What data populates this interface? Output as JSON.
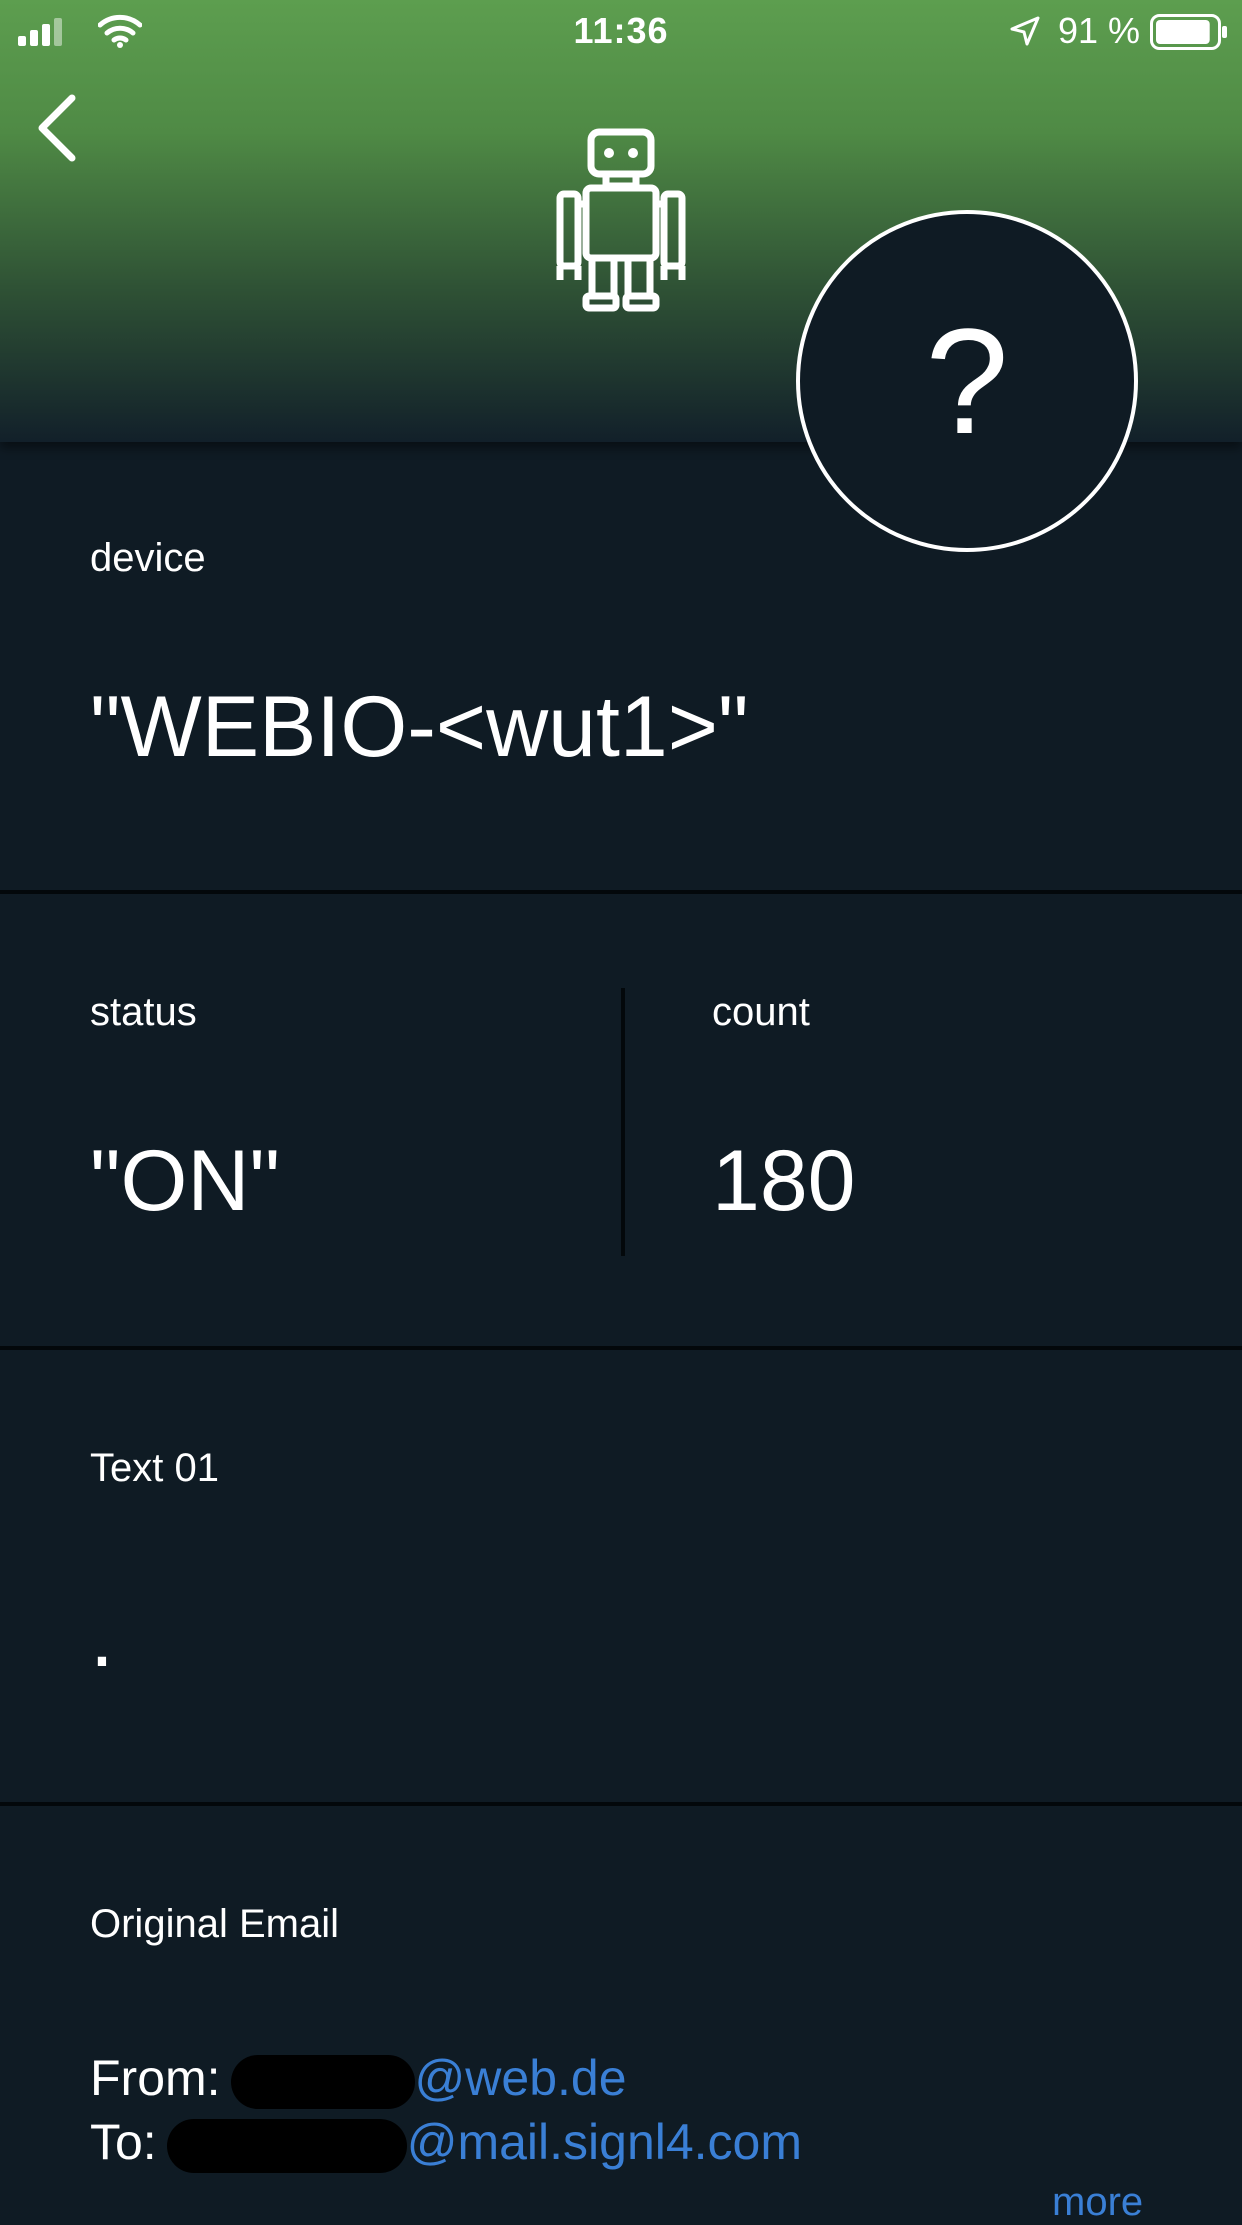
{
  "status_bar": {
    "time": "11:36",
    "battery_percent": "91 %",
    "battery_level": 0.91,
    "icons": [
      "signal-icon",
      "wifi-icon",
      "location-arrow-icon",
      "battery-icon"
    ]
  },
  "header": {
    "back_icon": "chevron-left-icon",
    "avatar_icon": "robot-icon",
    "help_symbol": "?",
    "gradient_top_color": "#5d9e4f",
    "gradient_bottom_color": "#12202a"
  },
  "fields": {
    "device": {
      "label": "device",
      "value": "\"WEBIO-<wut1>\""
    },
    "status": {
      "label": "status",
      "value": "\"ON\""
    },
    "count": {
      "label": "count",
      "value": "180"
    },
    "text01": {
      "label": "Text 01",
      "value": "."
    }
  },
  "original_email": {
    "label": "Original Email",
    "from_label": "From:",
    "from_domain": "@web.de",
    "to_label": "To:",
    "to_domain": "@mail.signl4.com",
    "more_label": "more"
  },
  "colors": {
    "background": "#0f1b24",
    "link": "#3a7fd5",
    "divider": "#03080b"
  }
}
